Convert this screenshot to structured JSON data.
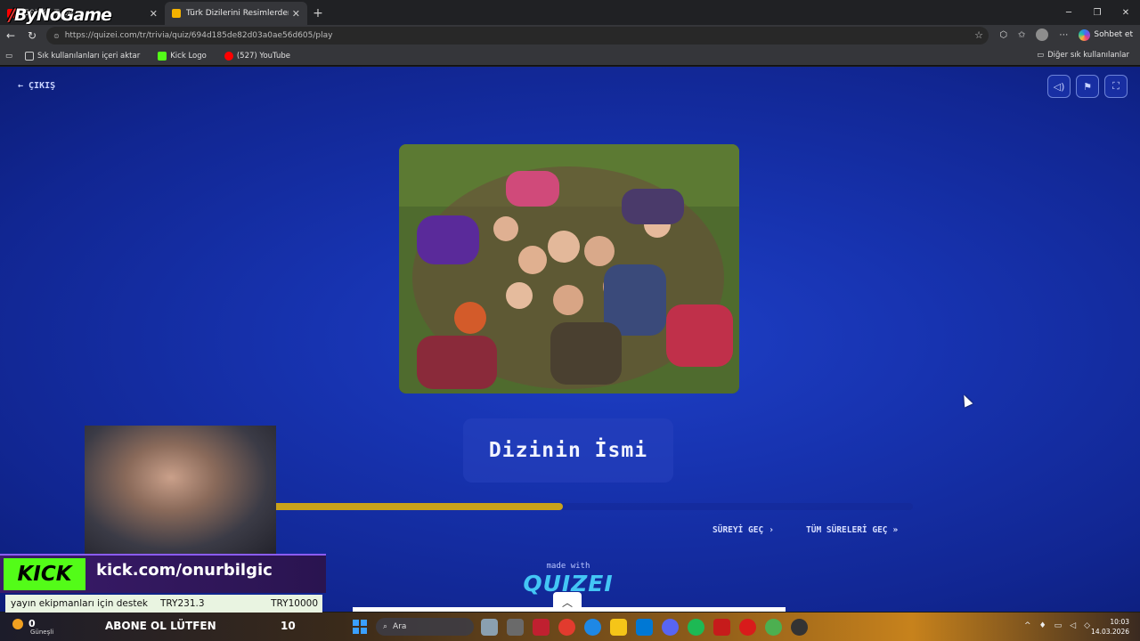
{
  "browser": {
    "tabs": [
      {
        "title": "(59) YouTube"
      },
      {
        "title": "Türk Dizilerini Resimlerden Tahmin"
      }
    ],
    "url": "https://quizei.com/tr/trivia/quiz/694d185de82d03a0ae56d605/play",
    "copilot_label": "Sohbet et",
    "bookmarks": [
      {
        "label": "Sık kullanılanları içeri aktar"
      },
      {
        "label": "Kick Logo"
      },
      {
        "label": "(527) YouTube"
      }
    ],
    "other_bookmarks": "Diğer sık kullanılanlar"
  },
  "overlay": {
    "channel_logo": "ByNoGame"
  },
  "quiz": {
    "exit_label": "ÇIKIŞ",
    "image_alt": "Group of people lying on grass in a circle",
    "answer_title": "Dizinin İsmi",
    "progress": 0.49,
    "skip_label": "SÜREYİ GEÇ",
    "skip_all_label": "TÜM SÜRELERİ GEÇ",
    "made_with": "made with",
    "brand": "QUIZEI"
  },
  "stream": {
    "kick_logo": "KICK",
    "kick_url": "kick.com/onurbilgic",
    "donation_text": "yayın ekipmanları için destek",
    "donation_amount": "TRY231.3",
    "donation_goal": "TRY10000",
    "weather_temp": "0",
    "weather_desc": "Güneşli",
    "banner": "ABONE OL LÜTFEN",
    "counter": "10"
  },
  "taskbar": {
    "search_placeholder": "Ara",
    "time": "10:03",
    "date": "14.03.2026"
  },
  "colors": {
    "page_bg": "#1733b0",
    "progress": "#c9a21b",
    "kick_green": "#53fc18",
    "quizei": "#43c6f5"
  }
}
